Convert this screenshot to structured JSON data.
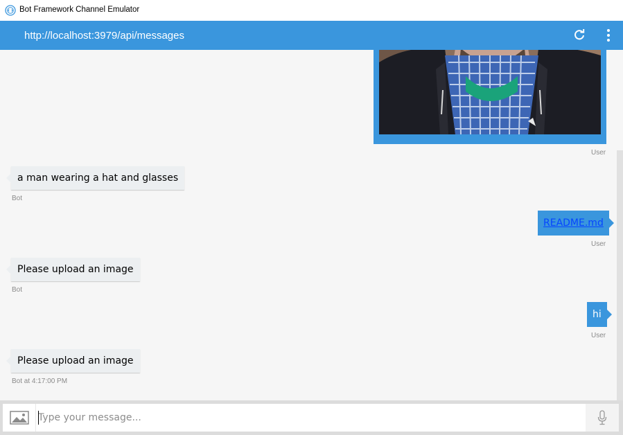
{
  "window": {
    "title": "Bot Framework Channel Emulator"
  },
  "header": {
    "url": "http://localhost:3979/api/messages",
    "refresh_icon": "refresh-icon",
    "more_icon": "more-vertical-icon",
    "color": "#3a96dd"
  },
  "messages": [
    {
      "from": "user",
      "type": "image-attachment",
      "meta": "User"
    },
    {
      "from": "bot",
      "text": "a man wearing a hat and glasses",
      "meta": "Bot"
    },
    {
      "from": "user",
      "text": "README.md",
      "type": "link",
      "meta": "User"
    },
    {
      "from": "bot",
      "text": "Please upload an image",
      "meta": "Bot"
    },
    {
      "from": "user",
      "text": "hi",
      "meta": "User"
    },
    {
      "from": "bot",
      "text": "Please upload an image",
      "meta": "Bot at 4:17:00 PM"
    }
  ],
  "composer": {
    "placeholder": "Type your message...",
    "upload_icon": "image-upload-icon",
    "mic_icon": "microphone-icon"
  },
  "colors": {
    "accent": "#3a96dd",
    "bot_bubble": "#eceff1",
    "background": "#f6f6f6"
  }
}
